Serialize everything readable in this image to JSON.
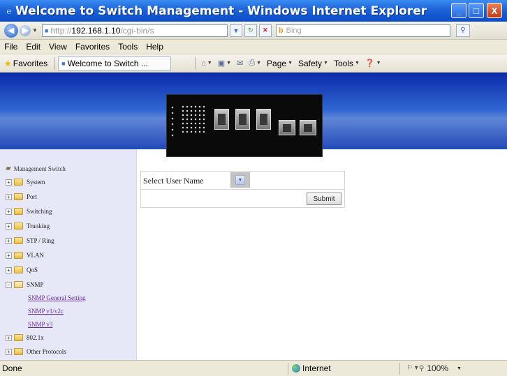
{
  "window": {
    "title": "Welcome to Switch Management - Windows Internet Explorer",
    "min_glyph": "_",
    "max_glyph": "□",
    "close_glyph": "X"
  },
  "address": {
    "url_proto": "http://",
    "url_host": "192.168.1.10",
    "url_path": "/cgi-bin/s",
    "search_placeholder": "Bing"
  },
  "menu": [
    "File",
    "Edit",
    "View",
    "Favorites",
    "Tools",
    "Help"
  ],
  "favorites_bar": {
    "favorites_label": "Favorites",
    "tab_title": "Welcome to Switch ...",
    "commands": [
      "Page",
      "Safety",
      "Tools"
    ]
  },
  "sidebar": {
    "root": "Management Switch",
    "nodes": [
      {
        "label": "System",
        "expanded": false
      },
      {
        "label": "Port",
        "expanded": false
      },
      {
        "label": "Switching",
        "expanded": false
      },
      {
        "label": "Trunking",
        "expanded": false
      },
      {
        "label": "STP / Ring",
        "expanded": false
      },
      {
        "label": "VLAN",
        "expanded": false
      },
      {
        "label": "QoS",
        "expanded": false
      },
      {
        "label": "SNMP",
        "expanded": true
      },
      {
        "label": "802.1x",
        "expanded": false
      },
      {
        "label": "Other Protocols",
        "expanded": false
      }
    ],
    "snmp_children": [
      "SNMP General Setting",
      "SNMP v1/v2c",
      "SNMP v3"
    ]
  },
  "form": {
    "select_label": "Select User Name",
    "select_value": "",
    "submit_label": "Submit"
  },
  "status": {
    "text": "Done",
    "zone": "Internet",
    "zoom": "100%"
  },
  "icons": {
    "favorites": "star-icon",
    "zone": "globe-icon"
  },
  "colors": {
    "titlebar": "#1c63d8",
    "banner": "#2f65d2",
    "sidebar": "#e6e8f8",
    "link_visited": "#6a2aa0"
  }
}
